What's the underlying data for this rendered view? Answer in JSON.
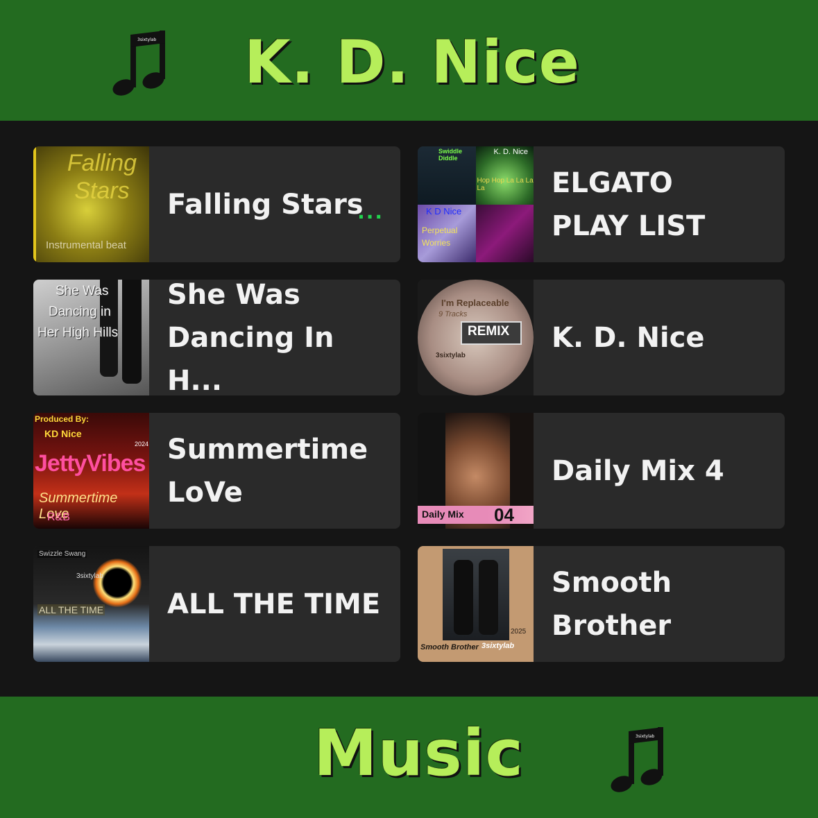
{
  "header": {
    "title": "K. D. Nice",
    "icon": "music-note-icon",
    "icon_caption": "3sixtylab"
  },
  "footer": {
    "title": "Music",
    "icon": "music-note-icon",
    "icon_caption": "3sixtylab"
  },
  "colors": {
    "band": "#236b20",
    "title": "#b6ee5a",
    "background": "#151515",
    "card": "#2a2a2a",
    "more_dots": "#22d34f"
  },
  "tiles": [
    {
      "title_lines": [
        "Falling Stars"
      ],
      "more": "...",
      "art_text": {
        "title": "Falling Stars",
        "subtitle": "Instrumental beat"
      }
    },
    {
      "title_lines": [
        "ELGATO",
        "PLAY LIST"
      ],
      "art_text": {
        "a": "Swiddle Diddle",
        "b": "K. D. Nice",
        "c": "Hop Hop La La La La",
        "d": "K D Nice",
        "e": "Perpetual Worries"
      }
    },
    {
      "title_lines": [
        "She Was",
        "Dancing In H..."
      ],
      "art_text": {
        "l1": "She Was",
        "l2": "Dancing in",
        "l3": "Her High Hills"
      }
    },
    {
      "title_lines": [
        "K. D. Nice"
      ],
      "art_text": {
        "top": "I'm Replaceable",
        "sub": "9 Tracks",
        "badge": "REMIX",
        "label": "3sixtylab"
      }
    },
    {
      "title_lines": [
        "Summertime",
        "LoVe"
      ],
      "art_text": {
        "produced": "Produced By:",
        "by": "KD Nice",
        "year": "2024",
        "name": "JettyVibes",
        "script": "Summertime Love",
        "genre": "R&B"
      }
    },
    {
      "title_lines": [
        "Daily Mix 4"
      ],
      "art_text": {
        "tag": "Daily Mix",
        "num": "04"
      }
    },
    {
      "title_lines": [
        "ALL THE TIME"
      ],
      "art_text": {
        "a": "Swizzle Swang",
        "b": "3sixtylab",
        "c": "ALL THE TIME"
      }
    },
    {
      "title_lines": [
        "Smooth",
        "Brother"
      ],
      "art_text": {
        "year": "2025",
        "a": "Smooth Brother",
        "b": "3sixtylab"
      }
    }
  ]
}
